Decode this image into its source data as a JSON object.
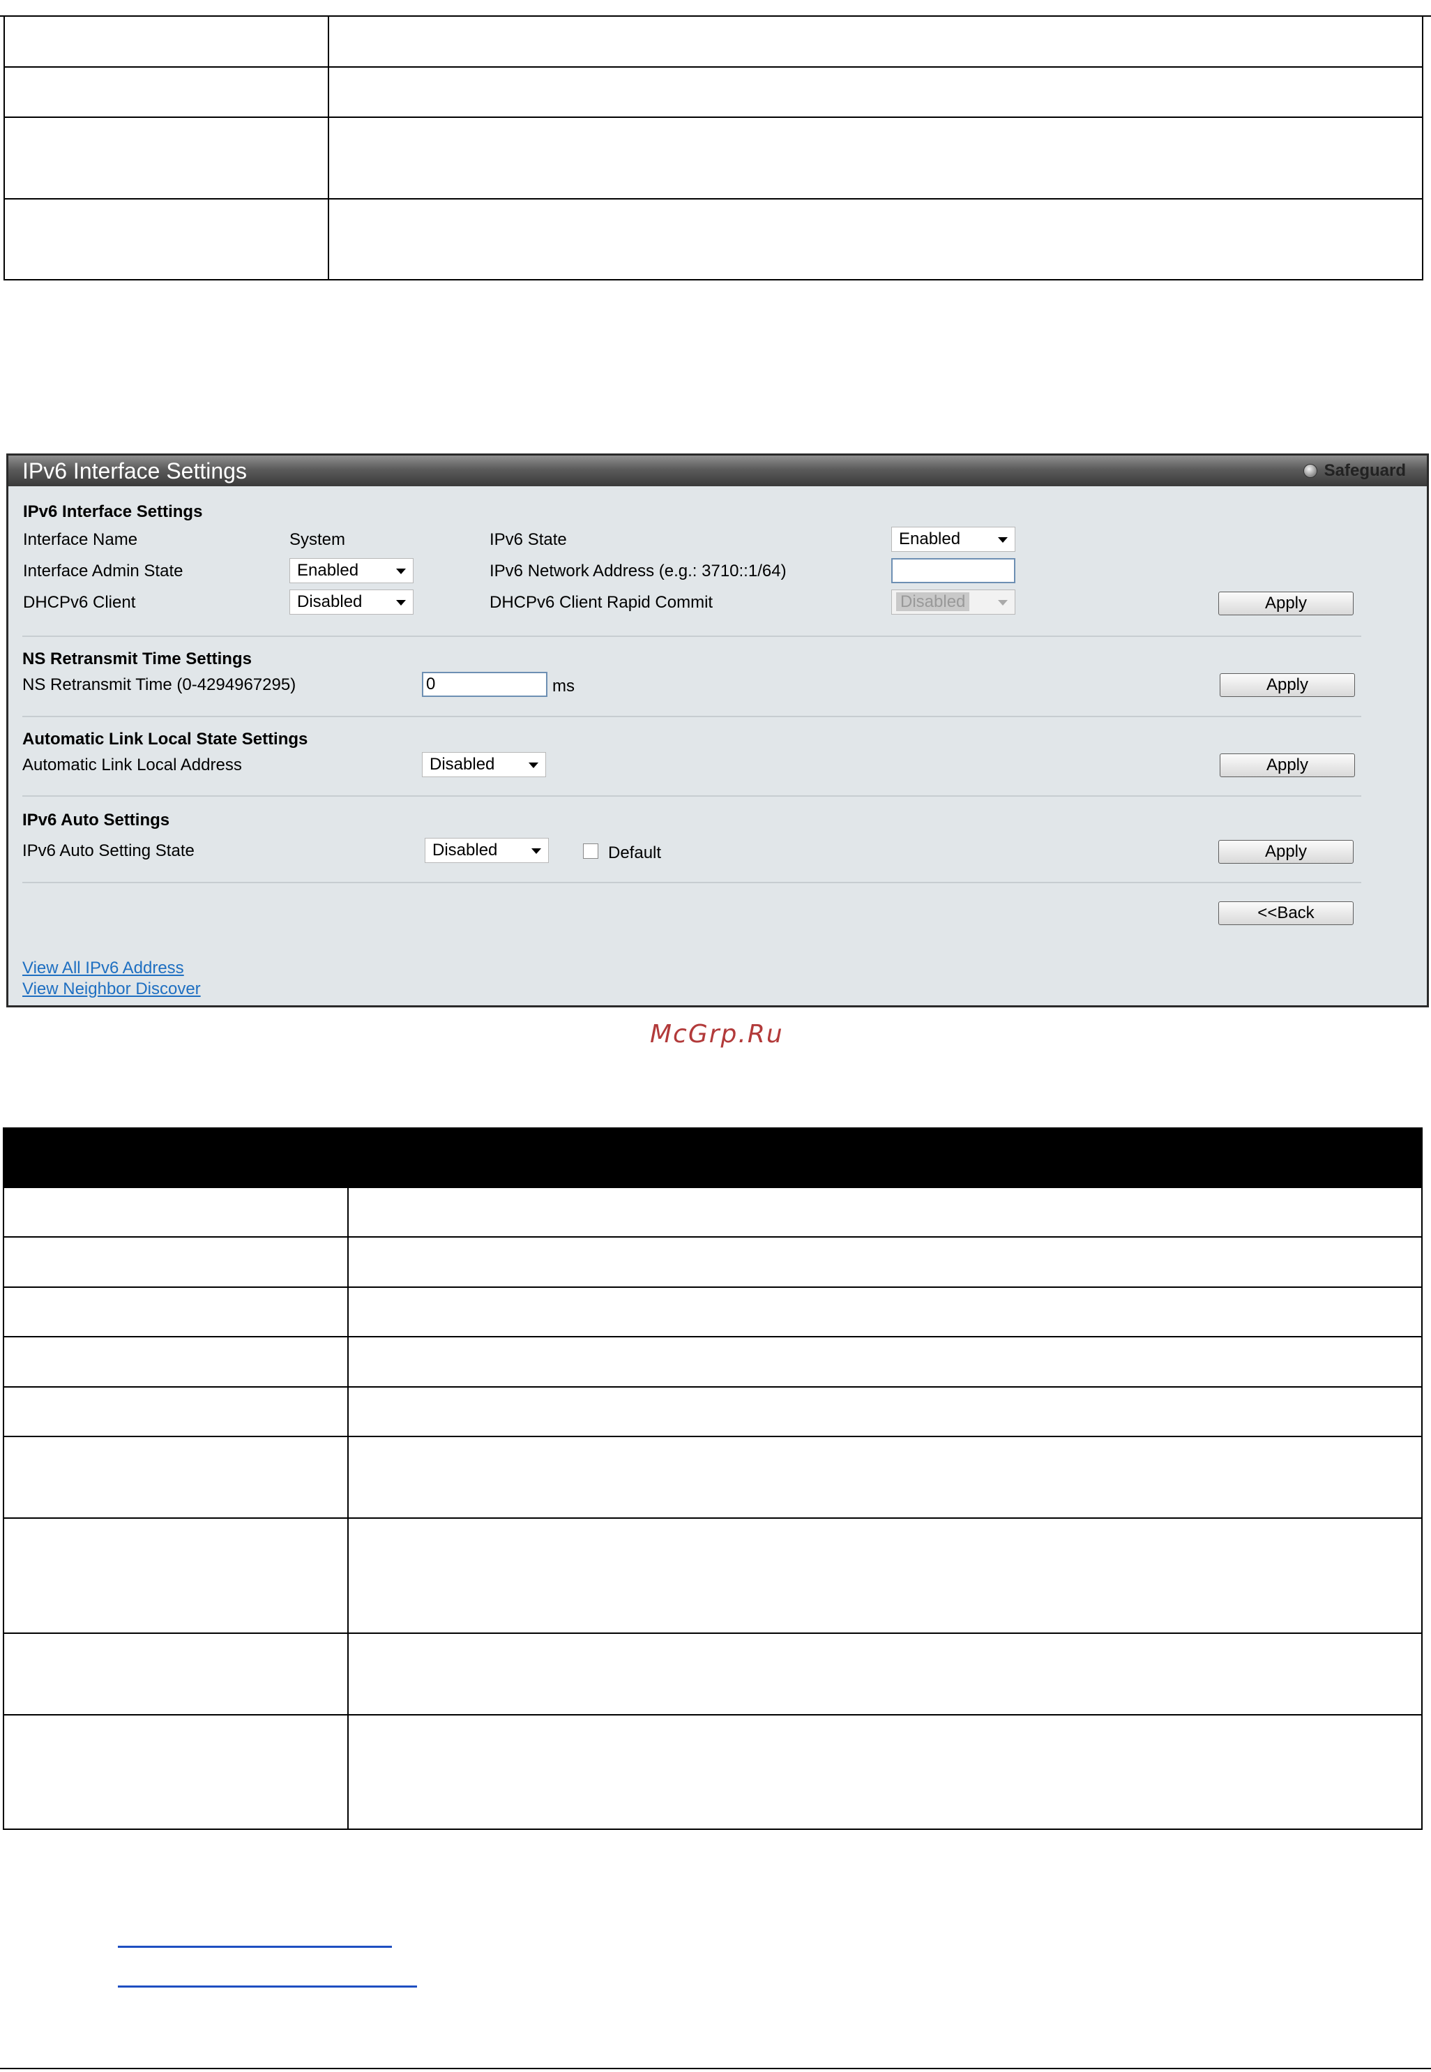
{
  "panel": {
    "title": "IPv6 Interface Settings",
    "safeguard": "Safeguard",
    "section_ipv6": {
      "heading": "IPv6 Interface Settings",
      "interface_name_label": "Interface Name",
      "interface_name_value": "System",
      "ipv6_state_label": "IPv6 State",
      "ipv6_state_value": "Enabled",
      "admin_state_label": "Interface Admin State",
      "admin_state_value": "Enabled",
      "network_address_label": "IPv6 Network Address (e.g.: 3710::1/64)",
      "network_address_value": "",
      "dhcpv6_client_label": "DHCPv6 Client",
      "dhcpv6_client_value": "Disabled",
      "rapid_commit_label": "DHCPv6 Client Rapid Commit",
      "rapid_commit_value": "Disabled",
      "apply_label": "Apply"
    },
    "section_ns": {
      "heading": "NS Retransmit Time Settings",
      "time_label": "NS Retransmit Time (0-4294967295)",
      "time_value": "0",
      "unit": "ms",
      "apply_label": "Apply"
    },
    "section_link_local": {
      "heading": "Automatic Link Local State Settings",
      "address_label": "Automatic Link Local Address",
      "address_value": "Disabled",
      "apply_label": "Apply"
    },
    "section_auto": {
      "heading": "IPv6 Auto Settings",
      "state_label": "IPv6 Auto Setting State",
      "state_value": "Disabled",
      "default_label": "Default",
      "default_checked": false,
      "apply_label": "Apply"
    },
    "back_label": "<<Back",
    "links": {
      "view_all": "View All IPv6 Address",
      "view_neighbor": "View Neighbor Discover"
    }
  },
  "watermark": "McGrp.Ru",
  "colors": {
    "panel_bg": "#e1e6e9",
    "title_bar": "#4a4a4a",
    "link": "#1e6fc1",
    "watermark": "#b23a3a"
  }
}
